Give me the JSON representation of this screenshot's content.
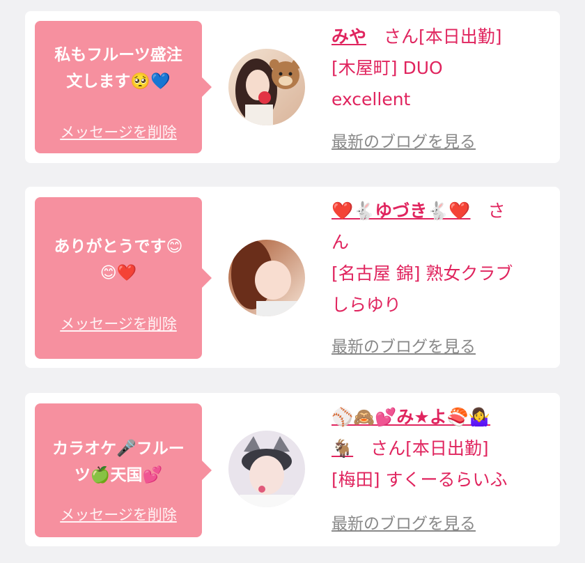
{
  "colors": {
    "bubble": "#f6909f",
    "accent": "#e0245e",
    "link_gray": "#888888",
    "background": "#f1f1f3"
  },
  "messages": [
    {
      "message_line1": "私もフルーツ盛注",
      "message_line2": "文します🥺💙",
      "delete_label": "メッセージを削除",
      "name": "みや",
      "suffix_line1": "さん[本日出勤]",
      "info_line2": "[木屋町] DUO",
      "info_line3": "excellent",
      "blog_label": "最新のブログを見る"
    },
    {
      "message_line1": "ありがとうです😊",
      "message_line2": "😊❤️",
      "delete_label": "メッセージを削除",
      "name": "❤️🐇ゆづき🐇❤️",
      "suffix_line1": "さ",
      "info_line2": "ん",
      "info_line3": "[名古屋 錦] 熟女クラブ",
      "info_line4": "しらゆり",
      "blog_label": "最新のブログを見る"
    },
    {
      "message_line1": "カラオケ🎤フルー",
      "message_line2": "ツ🍏天国💕",
      "delete_label": "メッセージを削除",
      "name_line1": "⚾🙈💕み★よ🍣🤷‍♀️",
      "name_line2": "🐐",
      "suffix_line2": "さん[本日出勤]",
      "info_line3": "[梅田] すくーるらいふ",
      "blog_label": "最新のブログを見る"
    }
  ]
}
